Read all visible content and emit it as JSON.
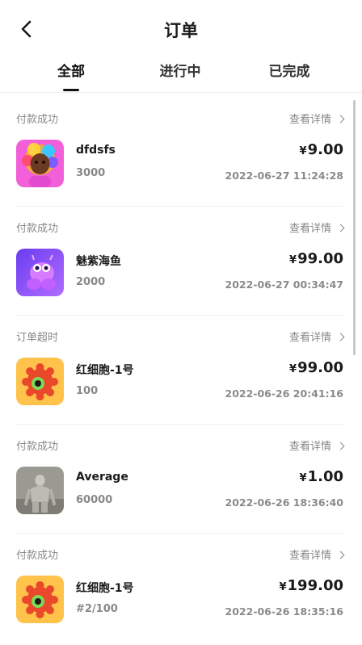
{
  "header": {
    "title": "订单"
  },
  "tabs": [
    {
      "label": "全部"
    },
    {
      "label": "进行中"
    },
    {
      "label": "已完成"
    }
  ],
  "currency_symbol": "¥",
  "detail_label": "查看详情",
  "orders": [
    {
      "status": "付款成功",
      "name": "dfdsfs",
      "qty": "3000",
      "price": "9.00",
      "time": "2022-06-27 11:24:28",
      "thumb": "avatar-girl"
    },
    {
      "status": "付款成功",
      "name": "魅紫海鱼",
      "qty": "2000",
      "price": "99.00",
      "time": "2022-06-27 00:34:47",
      "thumb": "purple-creature"
    },
    {
      "status": "订单超时",
      "name": "红细胞-1号",
      "qty": "100",
      "price": "99.00",
      "time": "2022-06-26 20:41:16",
      "thumb": "red-cell"
    },
    {
      "status": "付款成功",
      "name": "Average",
      "qty": "60000",
      "price": "1.00",
      "time": "2022-06-26 18:36:40",
      "thumb": "gray-statue"
    },
    {
      "status": "付款成功",
      "name": "红细胞-1号",
      "qty": "#2/100",
      "price": "199.00",
      "time": "2022-06-26 18:35:16",
      "thumb": "red-cell"
    }
  ]
}
